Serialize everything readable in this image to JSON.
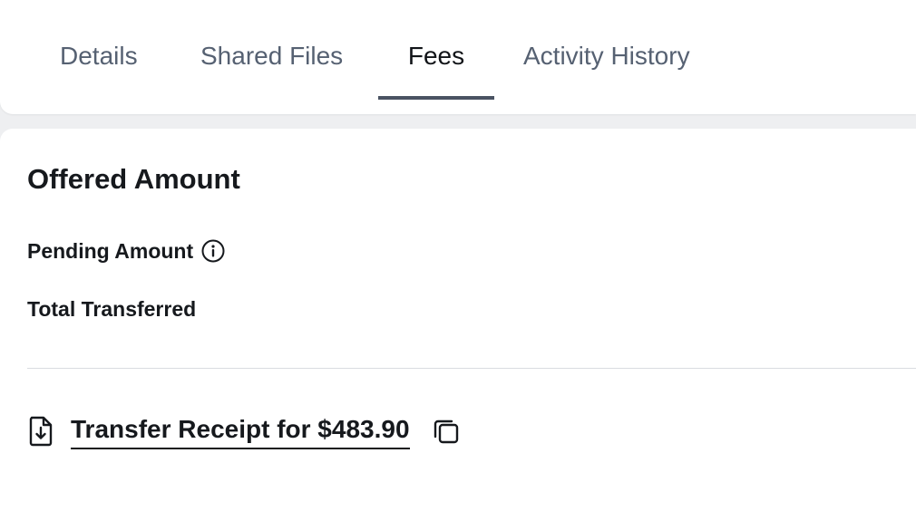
{
  "tabs": [
    {
      "label": "Details",
      "active": false
    },
    {
      "label": "Shared Files",
      "active": false
    },
    {
      "label": "Fees",
      "active": true
    },
    {
      "label": "Activity History",
      "active": false
    }
  ],
  "section": {
    "title": "Offered Amount",
    "pending_label": "Pending Amount",
    "total_label": "Total Transferred"
  },
  "receipt": {
    "link_text": "Transfer Receipt for $483.90"
  },
  "icons": {
    "info": "info-icon",
    "document": "file-download-icon",
    "copy": "copy-icon"
  },
  "colors": {
    "active_tab_underline": "#4a5362",
    "inactive_tab_text": "#566172",
    "text": "#16191d"
  }
}
